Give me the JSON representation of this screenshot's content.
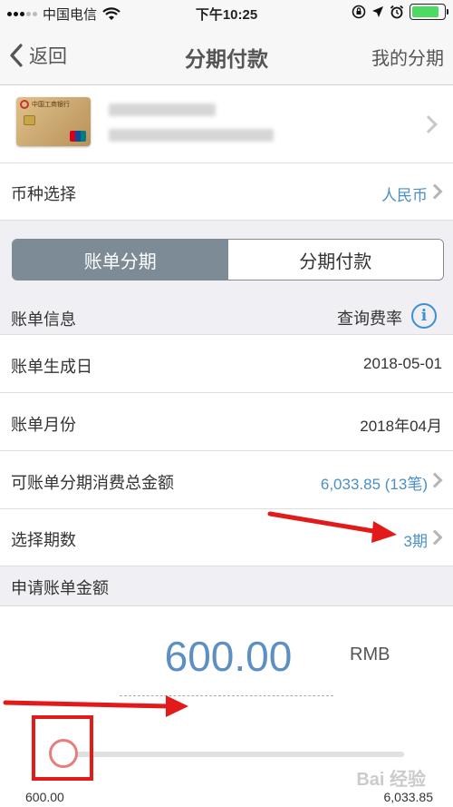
{
  "status_bar": {
    "carrier": "中国电信",
    "time": "下午10:25"
  },
  "nav": {
    "back_label": "返回",
    "title": "分期付款",
    "right_label": "我的分期"
  },
  "card": {
    "bank_name": "中国工商银行",
    "brand": "ICBC"
  },
  "currency": {
    "label": "币种选择",
    "value": "人民币"
  },
  "segmented": {
    "options": [
      "账单分期",
      "分期付款"
    ],
    "selected": "账单分期"
  },
  "bill_info": {
    "header_label": "账单信息",
    "query_label": "查询费率",
    "rows": [
      {
        "label": "账单生成日",
        "value": "2018-05-01"
      },
      {
        "label": "账单月份",
        "value": "2018年04月"
      },
      {
        "label": "可账单分期消费总金额",
        "value": "6,033.85 (13笔)"
      },
      {
        "label": "选择期数",
        "value": "3期"
      }
    ]
  },
  "amount": {
    "header_label": "申请账单金额",
    "value": "600.00",
    "unit": "RMB",
    "slider_min": "600.00",
    "slider_max": "6,033.85",
    "slider_fraction": 0
  },
  "watermark": "Bai 经验",
  "colors": {
    "accent": "#4a8fc7",
    "segment_active": "#7d8b96",
    "annotation": "#e31a1a",
    "knob": "#e67e7e"
  }
}
